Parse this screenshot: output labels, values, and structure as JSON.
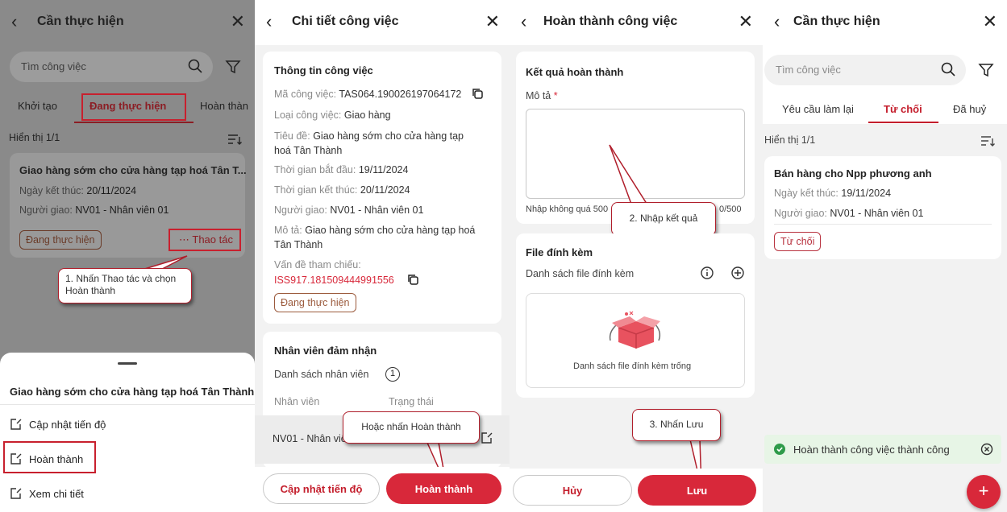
{
  "colors": {
    "accent": "#d8283a",
    "overlay": "#888888",
    "toast_bg": "#e7f5e6",
    "success": "#2f9b4a"
  },
  "p1": {
    "header": {
      "title": "Cần thực hiện"
    },
    "search": {
      "placeholder": "Tìm công việc"
    },
    "tabs": [
      "Khởi tạo",
      "Đang thực hiện",
      "Hoàn thàn"
    ],
    "count": "Hiển thị 1/1",
    "card": {
      "title": "Giao hàng sớm  cho cửa hàng tạp hoá Tân T...",
      "end_label": "Ngày kết thúc:",
      "end_value": "20/11/2024",
      "assigner_label": "Người giao:",
      "assigner_value": "NV01 - Nhân viên 01",
      "status": "Đang thực hiện",
      "action": "Thao tác"
    },
    "callout": "1. Nhấn Thao tác và chọn Hoàn thành",
    "sheet": {
      "title": "Giao hàng sớm  cho cửa hàng tạp hoá Tân Thành",
      "items": [
        "Cập nhật tiến độ",
        "Hoàn thành",
        "Xem chi tiết"
      ]
    }
  },
  "p2": {
    "header": {
      "title": "Chi tiết công việc"
    },
    "info": {
      "section": "Thông tin công việc",
      "code_label": "Mã công việc:",
      "code_value": "TAS064.190026197064172",
      "type_label": "Loại công việc:",
      "type_value": "Giao hàng",
      "title_label": "Tiêu đề:",
      "title_value_1": "Giao hàng sớm  cho cửa hàng tạp",
      "title_value_2": "hoá Tân Thành",
      "start_label": "Thời gian bắt đầu:",
      "start_value": "19/11/2024",
      "end_label": "Thời gian kết thúc:",
      "end_value": "20/11/2024",
      "assigner_label": "Người giao:",
      "assigner_value": "NV01 - Nhân viên 01",
      "desc_label": "Mô tả:",
      "desc_value_1": "Giao hàng sớm  cho cửa hàng tạp hoá",
      "desc_value_2": "Tân Thành",
      "ref_label": "Vấn đề tham chiếu:",
      "ref_value": "ISS917.181509444991556",
      "status": "Đang thực hiện"
    },
    "staff": {
      "section": "Nhân viên đảm nhận",
      "list_label": "Danh sách nhân viên",
      "list_count": "1",
      "col_staff": "Nhân viên",
      "col_status": "Trạng thái",
      "row_staff": "NV01 - Nhân viê"
    },
    "callout": "Hoặc nhấn Hoàn thành",
    "buttons": {
      "update": "Cập nhật tiến độ",
      "complete": "Hoàn thành"
    }
  },
  "p3": {
    "header": {
      "title": "Hoàn thành công việc"
    },
    "result": {
      "section": "Kết quả hoàn thành",
      "desc_label": "Mô tả",
      "required": "*",
      "hint": "Nhập không quá 500",
      "counter": "0/500"
    },
    "callout_input": "2. Nhập kết quả",
    "files": {
      "section": "File đính kèm",
      "list_label": "Danh sách file đính kèm",
      "empty": "Danh sách file đính kèm trống"
    },
    "callout_save": "3. Nhấn Lưu",
    "buttons": {
      "cancel": "Hủy",
      "save": "Lưu"
    }
  },
  "p4": {
    "header": {
      "title": "Cần thực hiện"
    },
    "search": {
      "placeholder": "Tìm công việc"
    },
    "tabs": [
      "Yêu cầu làm lại",
      "Từ chối",
      "Đã huỷ"
    ],
    "count": "Hiển thị 1/1",
    "card": {
      "title": "Bán hàng cho Npp phương anh",
      "end_label": "Ngày kết thúc:",
      "end_value": "19/11/2024",
      "assigner_label": "Người giao:",
      "assigner_value": "NV01 - Nhân viên 01",
      "status": "Từ chối"
    },
    "toast": "Hoàn thành công việc thành công",
    "fab": "+"
  }
}
